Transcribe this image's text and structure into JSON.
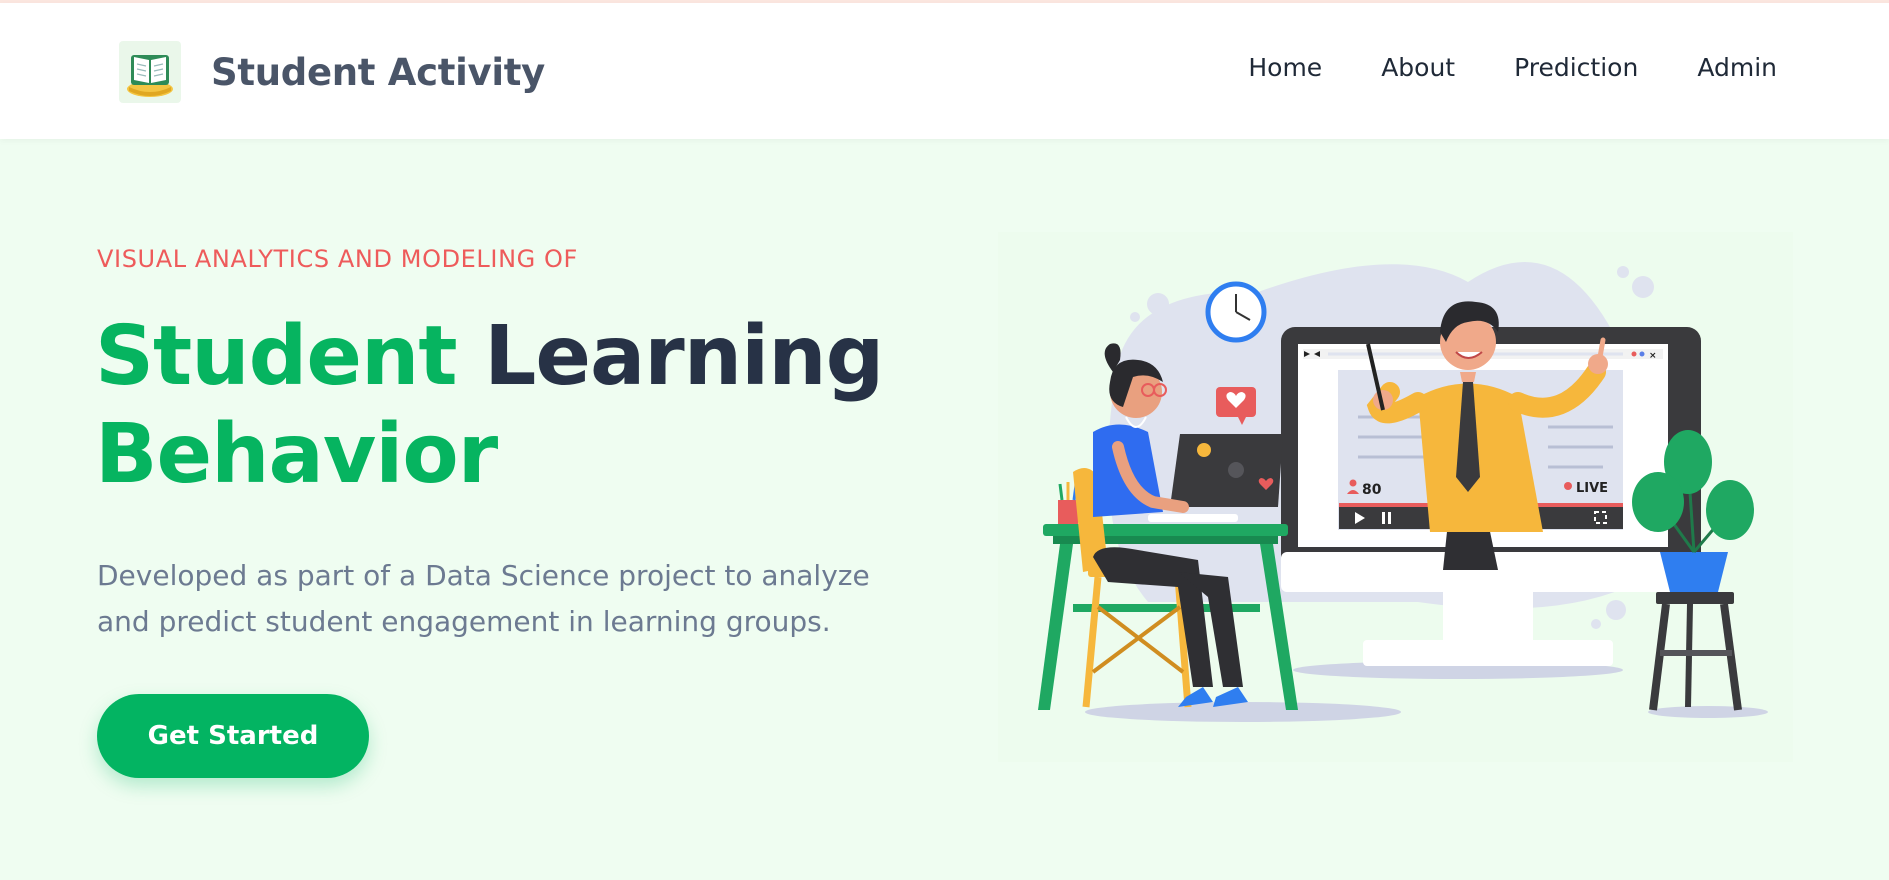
{
  "header": {
    "brand_name": "Student Activity",
    "logo_icon": "open-book-logo-icon"
  },
  "nav": {
    "items": [
      {
        "label": "Home"
      },
      {
        "label": "About"
      },
      {
        "label": "Prediction"
      },
      {
        "label": "Admin"
      }
    ]
  },
  "hero": {
    "eyebrow": "VISUAL ANALYTICS AND MODELING OF",
    "title_part1": "Student",
    "title_part2": "Learning",
    "title_part3": "Behavior",
    "description": "Developed as part of a Data Science project to analyze and predict student engagement in learning groups.",
    "cta_label": "Get Started"
  },
  "illustration": {
    "viewer_count": "80",
    "live_label": "LIVE"
  },
  "colors": {
    "accent_green": "#06b460",
    "eyebrow_red": "#ee5b5b",
    "page_bg": "#effdf1",
    "heading_dark": "#273246"
  }
}
